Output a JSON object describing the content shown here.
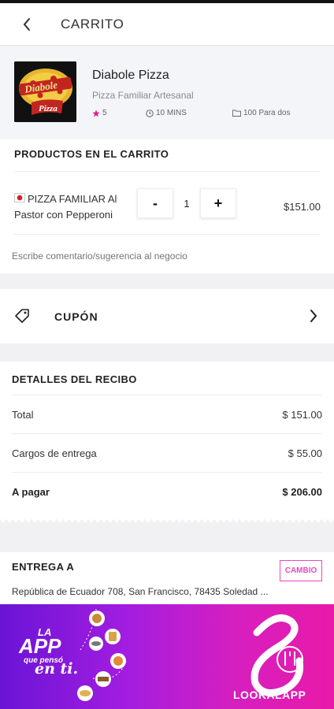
{
  "header": {
    "title": "CARRITO"
  },
  "store": {
    "name": "Diabole Pizza",
    "subtitle": "Pizza Familiar Artesanal",
    "rating": "5",
    "time": "10 MINS",
    "serves": "100 Para dos",
    "logo_text_top": "Diabole",
    "logo_text_bottom": "Pizza"
  },
  "products": {
    "title": "PRODUCTOS EN EL CARRITO",
    "items": [
      {
        "name": "PIZZA FAMILIAR Al Pastor con Pepperoni",
        "quantity": "1",
        "price": "$151.00",
        "minus": "-",
        "plus": "+"
      }
    ],
    "comment_placeholder": "Escribe comentario/sugerencia al negocio"
  },
  "coupon": {
    "label": "CUPÓN"
  },
  "receipt": {
    "title": "DETALLES DEL RECIBO",
    "rows": [
      {
        "label": "Total",
        "amount": "$ 151.00"
      },
      {
        "label": "Cargos de entrega",
        "amount": "$ 55.00"
      },
      {
        "label": "A pagar",
        "amount": "$ 206.00"
      }
    ]
  },
  "delivery": {
    "title": "ENTREGA A",
    "change_label": "CAMBIO",
    "address": "República de Ecuador 708, San Francisco, 78435 Soledad ..."
  },
  "banner": {
    "line1": "LA",
    "line2": "APP",
    "line3": "que pensó",
    "line4": "en ti.",
    "brand": "LOOKALAPP"
  },
  "colors": {
    "accent": "#e64bc0",
    "star": "#e0218a",
    "banner_start": "#6a14d6",
    "banner_end": "#e81aa8"
  }
}
